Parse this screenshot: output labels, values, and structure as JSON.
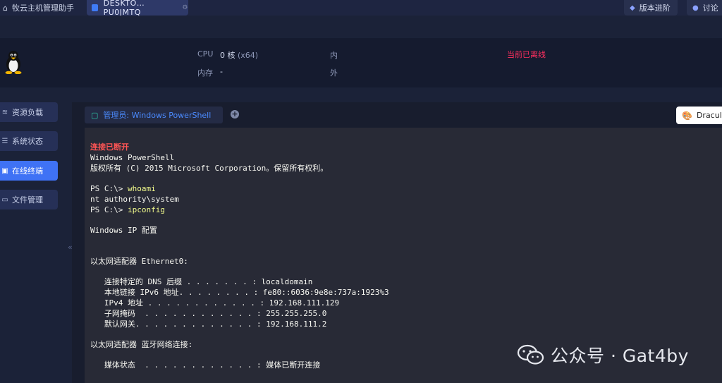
{
  "tabs": {
    "home_label": "牧云主机管理助手",
    "host_label": "DESKTO… PU0JMTQ"
  },
  "toolbar": {
    "upgrade_label": "版本进阶",
    "discuss_label": "讨论"
  },
  "host_info": {
    "cpu_label": "CPU",
    "cpu_value": "0 核",
    "cpu_arch": "(x64)",
    "memory_label": "内存",
    "memory_value": "-",
    "inner_label": "内",
    "outer_label": "外",
    "status_text": "当前已离线",
    "status_color": "#ff2f5f"
  },
  "sidebar": {
    "items": [
      {
        "label": "资源负载",
        "icon": "layers-icon"
      },
      {
        "label": "系统状态",
        "icon": "list-icon"
      },
      {
        "label": "在线终端",
        "icon": "terminal-icon",
        "active": true
      },
      {
        "label": "文件管理",
        "icon": "folder-icon"
      }
    ]
  },
  "terminal": {
    "tab_label": "管理员: Windows PowerShell",
    "theme_label": "Dracula",
    "lines": {
      "l0": "连接已断开",
      "l1": "Windows PowerShell",
      "l2": "版权所有 (C) 2015 Microsoft Corporation。保留所有权利。",
      "l3_prompt": "PS C:\\> ",
      "l3_cmd": "whoami",
      "l4": "nt authority\\system",
      "l5_prompt": "PS C:\\> ",
      "l5_cmd": "ipconfig",
      "l6": "Windows IP 配置",
      "l7": "以太网适配器 Ethernet0:",
      "l8": "   连接特定的 DNS 后缀 . . . . . . . : localdomain",
      "l9": "   本地链接 IPv6 地址. . . . . . . . : fe80::6036:9e8e:737a:1923%3",
      "l10": "   IPv4 地址 . . . . . . . . . . . . : 192.168.111.129",
      "l11": "   子网掩码  . . . . . . . . . . . . : 255.255.255.0",
      "l12": "   默认网关. . . . . . . . . . . . . : 192.168.111.2",
      "l13": "以太网适配器 蓝牙网络连接:",
      "l14": "   媒体状态  . . . . . . . . . . . . : 媒体已断开连接"
    }
  },
  "watermark": {
    "text": "公众号 · Gat4by"
  },
  "colors": {
    "accent": "#3f72f5",
    "terminal_bg": "#282a36",
    "error": "#ff5555",
    "command": "#f1fa8c"
  }
}
